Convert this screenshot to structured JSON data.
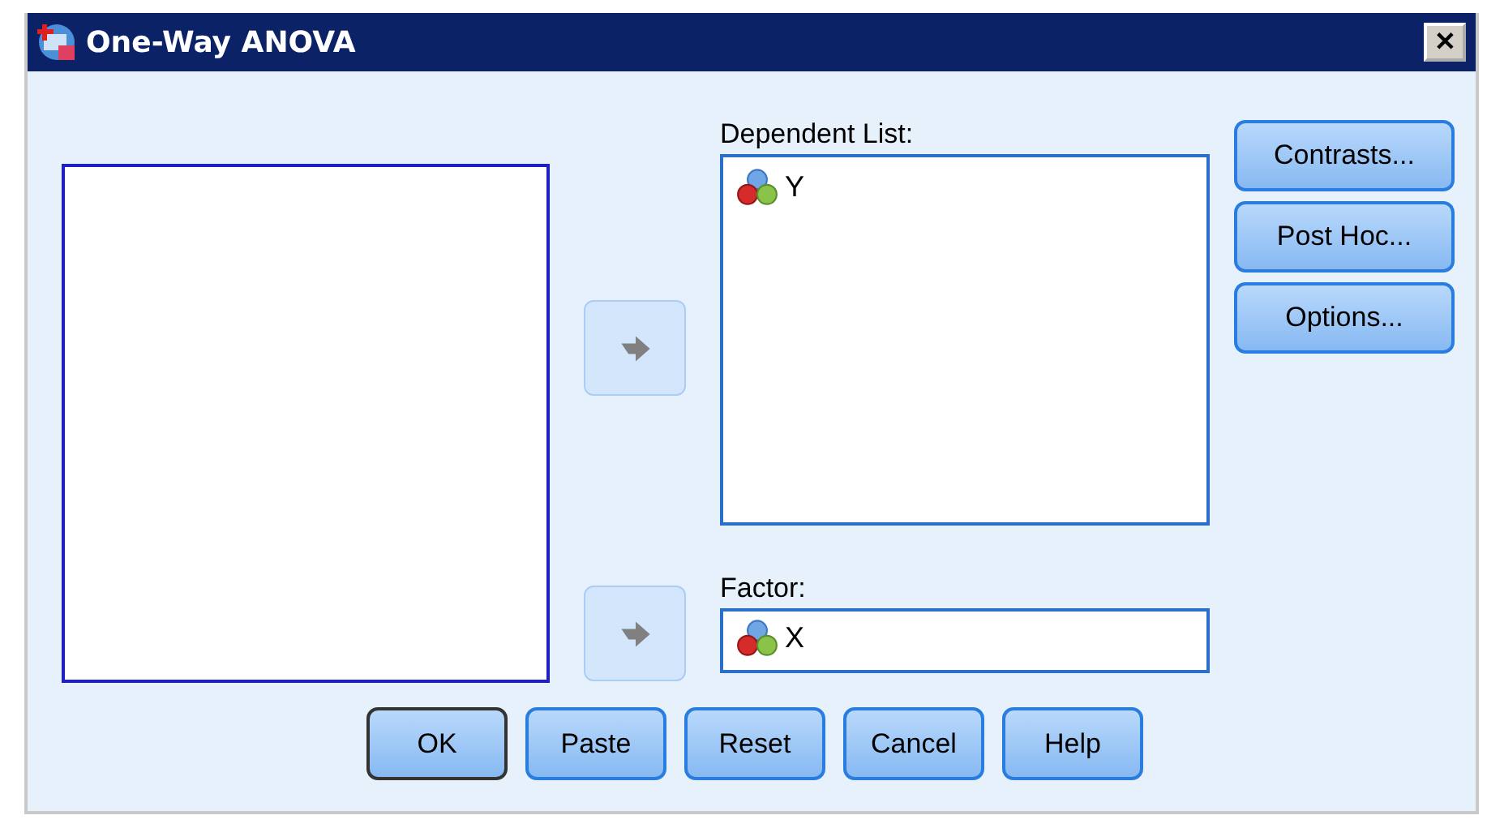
{
  "window": {
    "title": "One-Way ANOVA",
    "close": "✕"
  },
  "dependent_list": {
    "label": "Dependent List:",
    "items": [
      {
        "name": "Y"
      }
    ]
  },
  "factor": {
    "label": "Factor:",
    "value": "X"
  },
  "side_buttons": [
    "Contrasts...",
    "Post Hoc...",
    "Options..."
  ],
  "buttons": [
    {
      "label": "OK",
      "selected": true
    },
    {
      "label": "Paste",
      "selected": false
    },
    {
      "label": "Reset",
      "selected": false
    },
    {
      "label": "Cancel",
      "selected": false
    },
    {
      "label": "Help",
      "selected": false
    }
  ]
}
